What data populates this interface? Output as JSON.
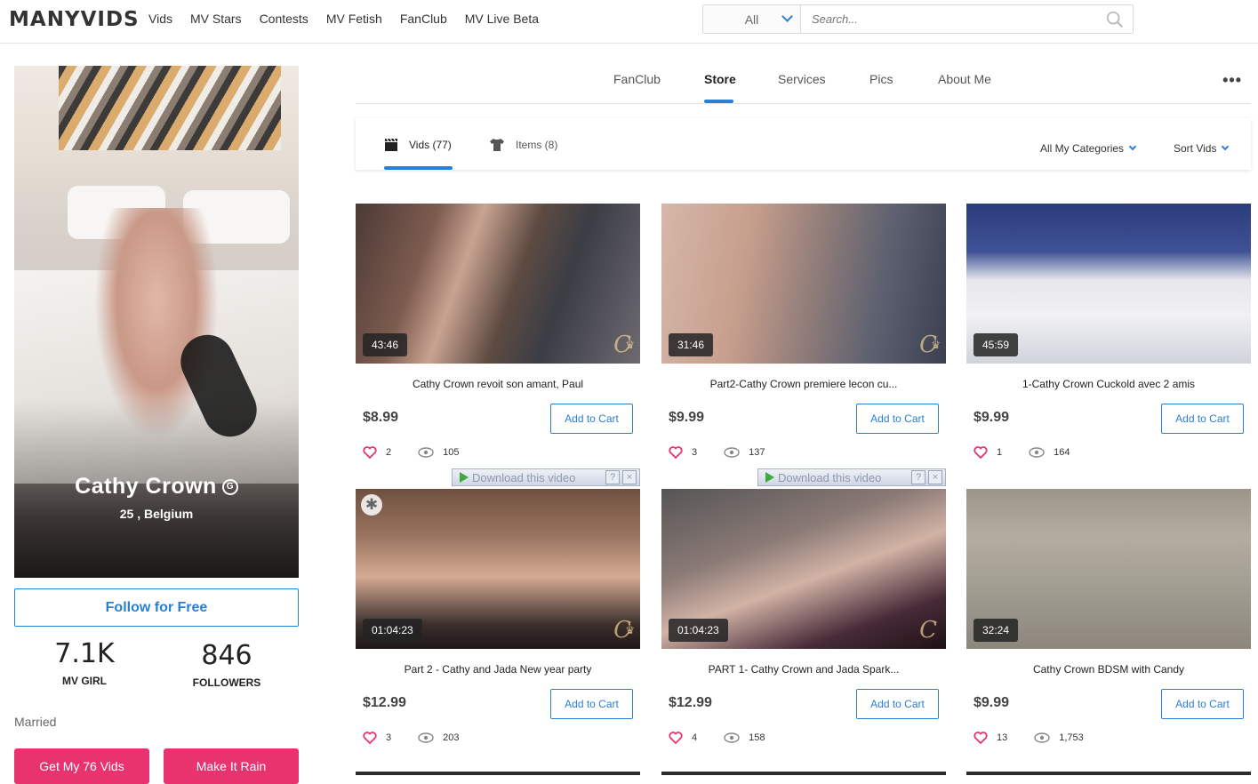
{
  "header": {
    "logo": "MANYVIDS",
    "nav": [
      "Vids",
      "MV Stars",
      "Contests",
      "MV Fetish",
      "FanClub",
      "MV Live Beta"
    ],
    "search_scope": "All",
    "search_placeholder": "Search..."
  },
  "profile": {
    "name": "Cathy Crown",
    "badge_letter": "G",
    "location": "25 , Belgium",
    "follow_label": "Follow for Free",
    "stats": [
      {
        "value": "7.1K",
        "label": "MV GIRL"
      },
      {
        "value": "846",
        "label": "FOLLOWERS"
      }
    ],
    "relationship": "Married",
    "get_vids_label": "Get My 76 Vids",
    "rain_label": "Make It Rain"
  },
  "tabs": [
    "FanClub",
    "Store",
    "Services",
    "Pics",
    "About Me"
  ],
  "active_tab": "Store",
  "store": {
    "sub_tabs": [
      {
        "label": "Vids (77)",
        "icon": "clapperboard-icon"
      },
      {
        "label": "Items (8)",
        "icon": "tshirt-icon"
      }
    ],
    "category_filter": "All My Categories",
    "sort_filter": "Sort Vids"
  },
  "download_bar_text": "Download this video",
  "cart_label": "Add to Cart",
  "videos": [
    {
      "duration": "43:46",
      "title": "Cathy Crown revoit son amant, Paul",
      "price": "$8.99",
      "likes": "2",
      "views": "105"
    },
    {
      "duration": "31:46",
      "title": "Part2-Cathy Crown premiere lecon cu...",
      "price": "$9.99",
      "likes": "3",
      "views": "137"
    },
    {
      "duration": "45:59",
      "title": "1-Cathy Crown Cuckold avec 2 amis",
      "price": "$9.99",
      "likes": "1",
      "views": "164"
    },
    {
      "duration": "01:04:23",
      "title": "Part 2 - Cathy and Jada New year party",
      "price": "$12.99",
      "likes": "3",
      "views": "203"
    },
    {
      "duration": "01:04:23",
      "title": "PART 1- Cathy Crown and Jada Spark...",
      "price": "$12.99",
      "likes": "4",
      "views": "158"
    },
    {
      "duration": "32:24",
      "title": "Cathy Crown BDSM with Candy",
      "price": "$9.99",
      "likes": "13",
      "views": "1,753"
    }
  ],
  "colors": {
    "accent": "#2a7fd3",
    "pink": "#e8336f",
    "heart": "#e8336f"
  }
}
